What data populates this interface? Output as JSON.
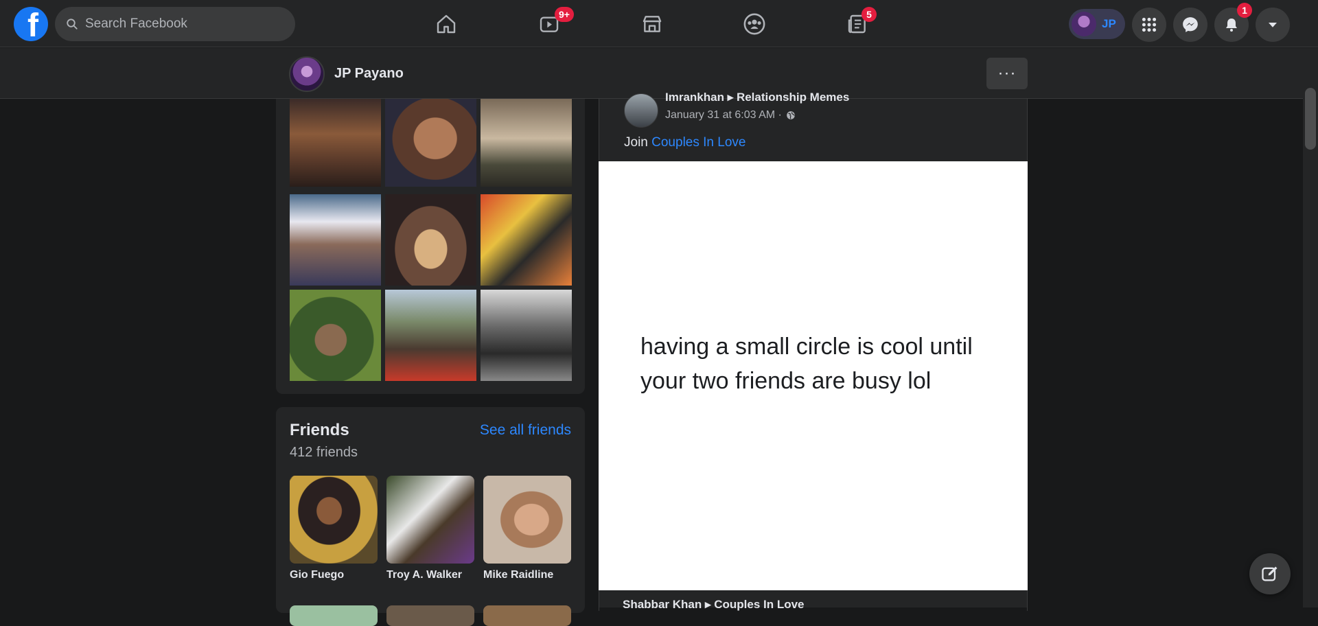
{
  "topbar": {
    "logo_letter": "f",
    "search_placeholder": "Search Facebook",
    "nav": [
      {
        "name": "home",
        "badge": ""
      },
      {
        "name": "watch",
        "badge": "9+"
      },
      {
        "name": "marketplace",
        "badge": ""
      },
      {
        "name": "groups",
        "badge": ""
      },
      {
        "name": "news",
        "badge": "5"
      }
    ],
    "me_initials": "JP",
    "notifications_badge": "1"
  },
  "profile": {
    "name": "JP Payano",
    "more_label": "···"
  },
  "photos": {
    "items": [
      {
        "alt": "group photo restaurant"
      },
      {
        "alt": "selfie woman"
      },
      {
        "alt": "wedding group"
      },
      {
        "alt": "collage friends"
      },
      {
        "alt": "group selfie"
      },
      {
        "alt": "two people smiling"
      },
      {
        "alt": "man in cap outdoors"
      },
      {
        "alt": "two men selfie"
      },
      {
        "alt": "black and white group"
      }
    ]
  },
  "friends": {
    "title": "Friends",
    "count": "412 friends",
    "see_all": "See all friends",
    "list": [
      {
        "name": "Gio Fuego"
      },
      {
        "name": "Troy A. Walker"
      },
      {
        "name": "Mike Raidline"
      }
    ]
  },
  "post": {
    "author": "Imrankhan ▸ Relationship Memes",
    "time": "January 31 at 6:03 AM ·",
    "text_prefix": "Join ",
    "link": "Couples In Love",
    "meme_text": "having a small circle is cool until your two friends are busy lol",
    "next_author": "Shabbar Khan ▸ Couples In Love"
  },
  "colors": {
    "background": "#18191a",
    "surface": "#242526",
    "accent": "#2d88ff",
    "badge": "#e41e3f",
    "brand": "#1877f2"
  }
}
